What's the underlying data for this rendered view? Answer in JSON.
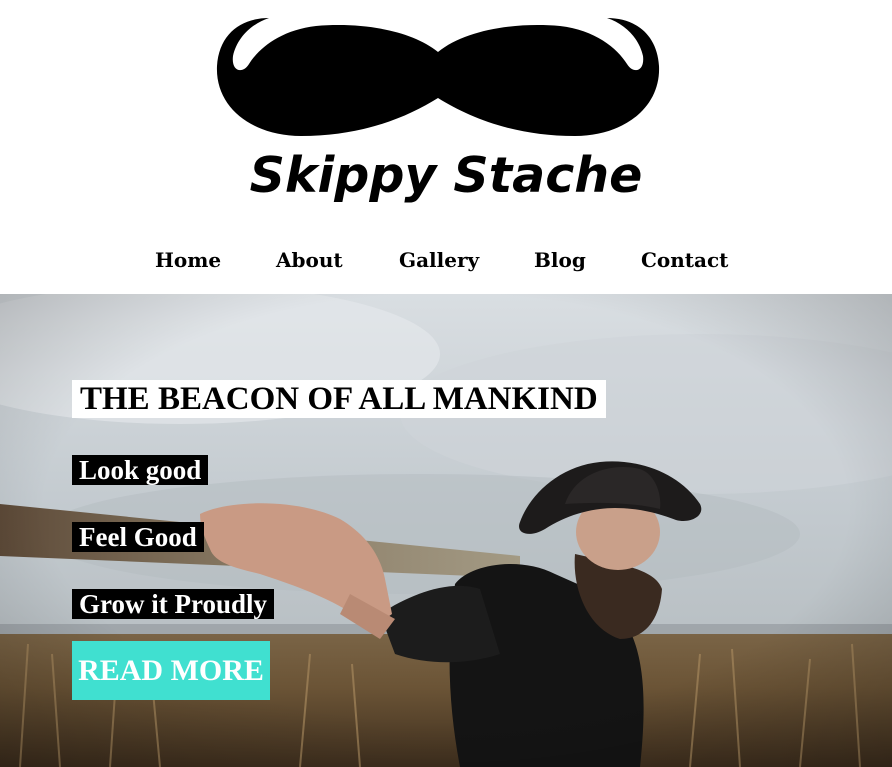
{
  "brand": {
    "name": "Skippy Stache",
    "logo_icon": "mustache-icon"
  },
  "nav": {
    "items": [
      {
        "label": "Home"
      },
      {
        "label": "About"
      },
      {
        "label": "Gallery"
      },
      {
        "label": "Blog"
      },
      {
        "label": "Contact"
      }
    ]
  },
  "hero": {
    "headline": "THE BEACON OF ALL MANKIND",
    "taglines": [
      "Look good",
      "Feel Good",
      "Grow it Proudly"
    ],
    "cta_label": "READ MORE"
  },
  "colors": {
    "accent": "#40e0d0",
    "text": "#000000",
    "background": "#ffffff"
  }
}
